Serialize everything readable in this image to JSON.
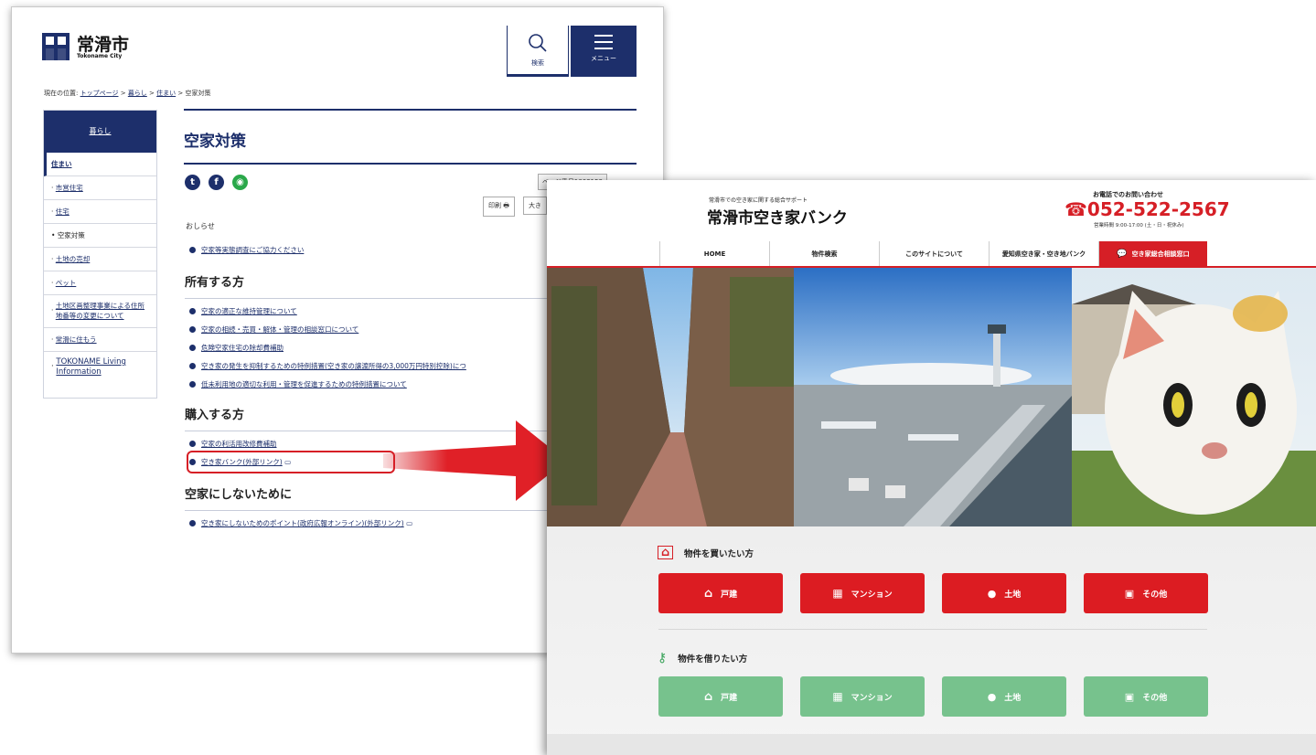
{
  "city": {
    "logo_name": "常滑市",
    "logo_sub": "Tokoname City",
    "search_label": "検索",
    "menu_label": "メニュー",
    "breadcrumb": {
      "prefix": "現在の位置:",
      "home": "トップページ",
      "sep1": ">",
      "kurashi": "暮らし",
      "sep2": ">",
      "sumai": "住まい",
      "sep3": ">",
      "current": "空家対策"
    },
    "sidebar": {
      "head": "暮らし",
      "items": [
        {
          "label": "住まい"
        },
        {
          "label": "市営住宅"
        },
        {
          "label": "住宅"
        },
        {
          "label": "空家対策"
        },
        {
          "label": "土地の売却"
        },
        {
          "label": "ペット"
        },
        {
          "label": "土地区画整理事業による住所地番等の変更について"
        },
        {
          "label": "常滑に住もう"
        },
        {
          "label": "TOKONAME Living Information"
        }
      ]
    },
    "title": "空家対策",
    "page_no": "ページ番号1003159",
    "print_label": "印刷 🖶",
    "bigger_label": "大き",
    "notice_heading": "おしらせ",
    "notice_link": "空家等実態調査にご協力ください",
    "owners": {
      "heading": "所有する方",
      "links": [
        "空家の適正な維持管理について",
        "空家の相続・売買・解体・管理の相談窓口について",
        "危険空家住宅の除却費補助",
        "空き家の発生を抑制するための特例措置(空き家の譲渡所得の3,000万円特別控除)につ",
        "低未利用地の適切な利用・管理を促進するための特例措置について"
      ]
    },
    "buyers": {
      "heading": "購入する方",
      "links": [
        "空家の利活用改修費補助",
        "空き家バンク(外部リンク)"
      ]
    },
    "prevent": {
      "heading": "空家にしないために",
      "links": [
        "空き家にしないためのポイント(政府広報オンライン)(外部リンク)"
      ]
    }
  },
  "bank": {
    "tagline": "常滑市での空き家に関する総合サポート",
    "title": "常滑市空き家バンク",
    "contact_label": "お電話でのお問い合わせ",
    "phone": "☎052-522-2567",
    "hours": "営業時間 9:00-17:00 (土・日・祝休み)",
    "nav": [
      "HOME",
      "物件検索",
      "このサイトについて",
      "愛知県空き家・空き地バンク",
      "空き家総合相談窓口"
    ],
    "buy_title": "物件を買いたい方",
    "rent_title": "物件を借りたい方",
    "categories": [
      "戸建",
      "マンション",
      "土地",
      "その他"
    ],
    "colors": {
      "accent_red": "#d61f26",
      "city_navy": "#1d2f6b",
      "rent_green": "#77c28d"
    }
  }
}
